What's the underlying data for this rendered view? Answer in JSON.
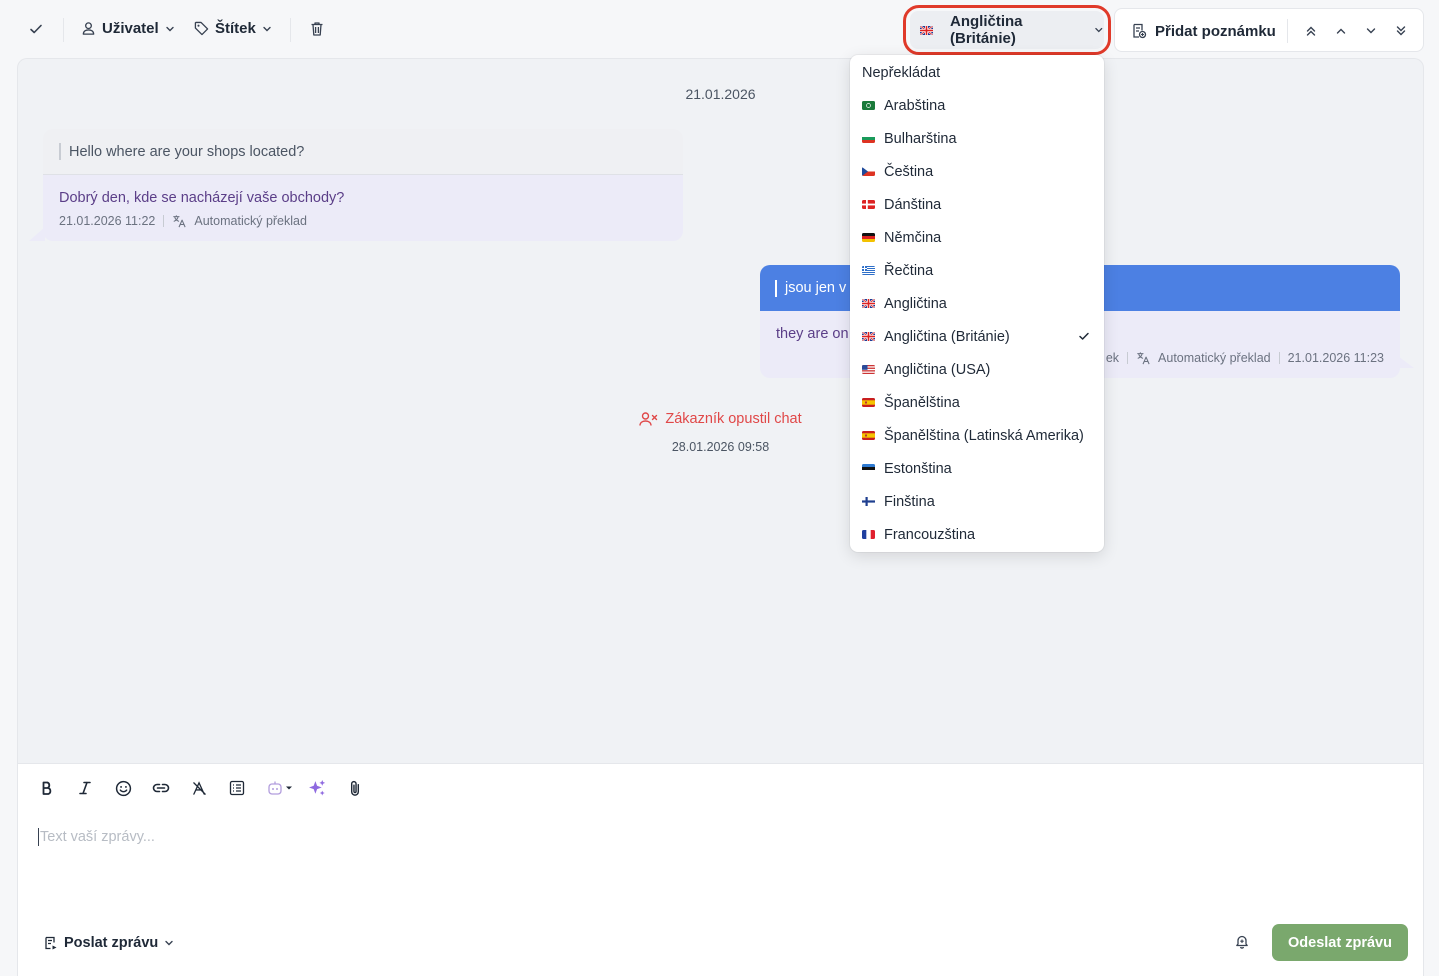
{
  "toolbar": {
    "user_label": "Uživatel",
    "tag_label": "Štítek",
    "language_label": "Angličtina (Británie)",
    "add_note_label": "Přidat poznámku"
  },
  "chat": {
    "date_divider": "21.01.2026",
    "incoming": {
      "original": "Hello where are your shops located?",
      "translation": "Dobrý den, kde se nacházejí vaše obchody?",
      "time": "21.01.2026 11:22",
      "translation_note": "Automatický překlad"
    },
    "outgoing": {
      "original": "jsou jen v",
      "translation": "they are on",
      "meta_partial": "ek",
      "translation_note": "Automatický překlad",
      "time": "21.01.2026 11:23"
    },
    "event": {
      "text": "Zákazník opustil chat",
      "time": "28.01.2026 09:58"
    }
  },
  "language_menu": {
    "items": [
      {
        "label": "Nepřekládat",
        "flag": "none",
        "selected": false
      },
      {
        "label": "Arabština",
        "flag": "sa",
        "selected": false
      },
      {
        "label": "Bulharština",
        "flag": "bg",
        "selected": false
      },
      {
        "label": "Čeština",
        "flag": "cz",
        "selected": false
      },
      {
        "label": "Dánština",
        "flag": "dk",
        "selected": false
      },
      {
        "label": "Němčina",
        "flag": "de",
        "selected": false
      },
      {
        "label": "Řečtina",
        "flag": "gr",
        "selected": false
      },
      {
        "label": "Angličtina",
        "flag": "gb",
        "selected": false
      },
      {
        "label": "Angličtina (Británie)",
        "flag": "gb",
        "selected": true
      },
      {
        "label": "Angličtina (USA)",
        "flag": "us",
        "selected": false
      },
      {
        "label": "Španělština",
        "flag": "es",
        "selected": false
      },
      {
        "label": "Španělština (Latinská Amerika)",
        "flag": "es",
        "selected": false
      },
      {
        "label": "Estonština",
        "flag": "ee",
        "selected": false
      },
      {
        "label": "Finština",
        "flag": "fi",
        "selected": false
      },
      {
        "label": "Francouzština",
        "flag": "fr",
        "selected": false
      }
    ]
  },
  "composer": {
    "placeholder": "Text vaší zprávy...",
    "send_mode_label": "Poslat zprávu",
    "send_button_label": "Odeslat zprávu"
  },
  "colors": {
    "accent_blue": "#4c80e3",
    "send_green": "#7aa86d",
    "highlight_red": "#e03a2a",
    "left_chat_red": "#e04848"
  }
}
